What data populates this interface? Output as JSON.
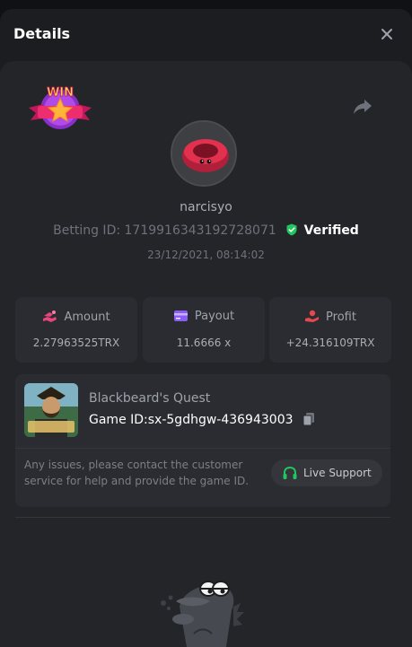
{
  "header": {
    "title": "Details"
  },
  "user": {
    "username": "narcisyo",
    "betting_label": "Betting ID:",
    "betting_id": "1719916343192728071",
    "verified": "Verified",
    "timestamp": "23/12/2021, 08:14:02"
  },
  "stats": {
    "amount": {
      "label": "Amount",
      "value": "2.27963525TRX"
    },
    "payout": {
      "label": "Payout",
      "value": "11.6666 x"
    },
    "profit": {
      "label": "Profit",
      "value": "+24.316109TRX"
    }
  },
  "game": {
    "name": "Blackbeard's Quest",
    "id_label": "Game ID:",
    "id_value": "sx-5gdhgw-436943003",
    "issue_text": "Any issues, please contact the customer service for help and provide the game ID.",
    "support_label": "Live Support"
  },
  "badge": {
    "text": "WIN"
  },
  "colors": {
    "accent_green": "#22c55e",
    "amount_icon": "#e8457a",
    "payout_icon": "#8b5cf6",
    "profit_icon": "#e5484d"
  },
  "icons": [
    "close-icon",
    "share-icon",
    "verified-shield-icon",
    "amount-icon",
    "payout-card-icon",
    "profit-hand-icon",
    "copy-icon",
    "headset-icon"
  ]
}
